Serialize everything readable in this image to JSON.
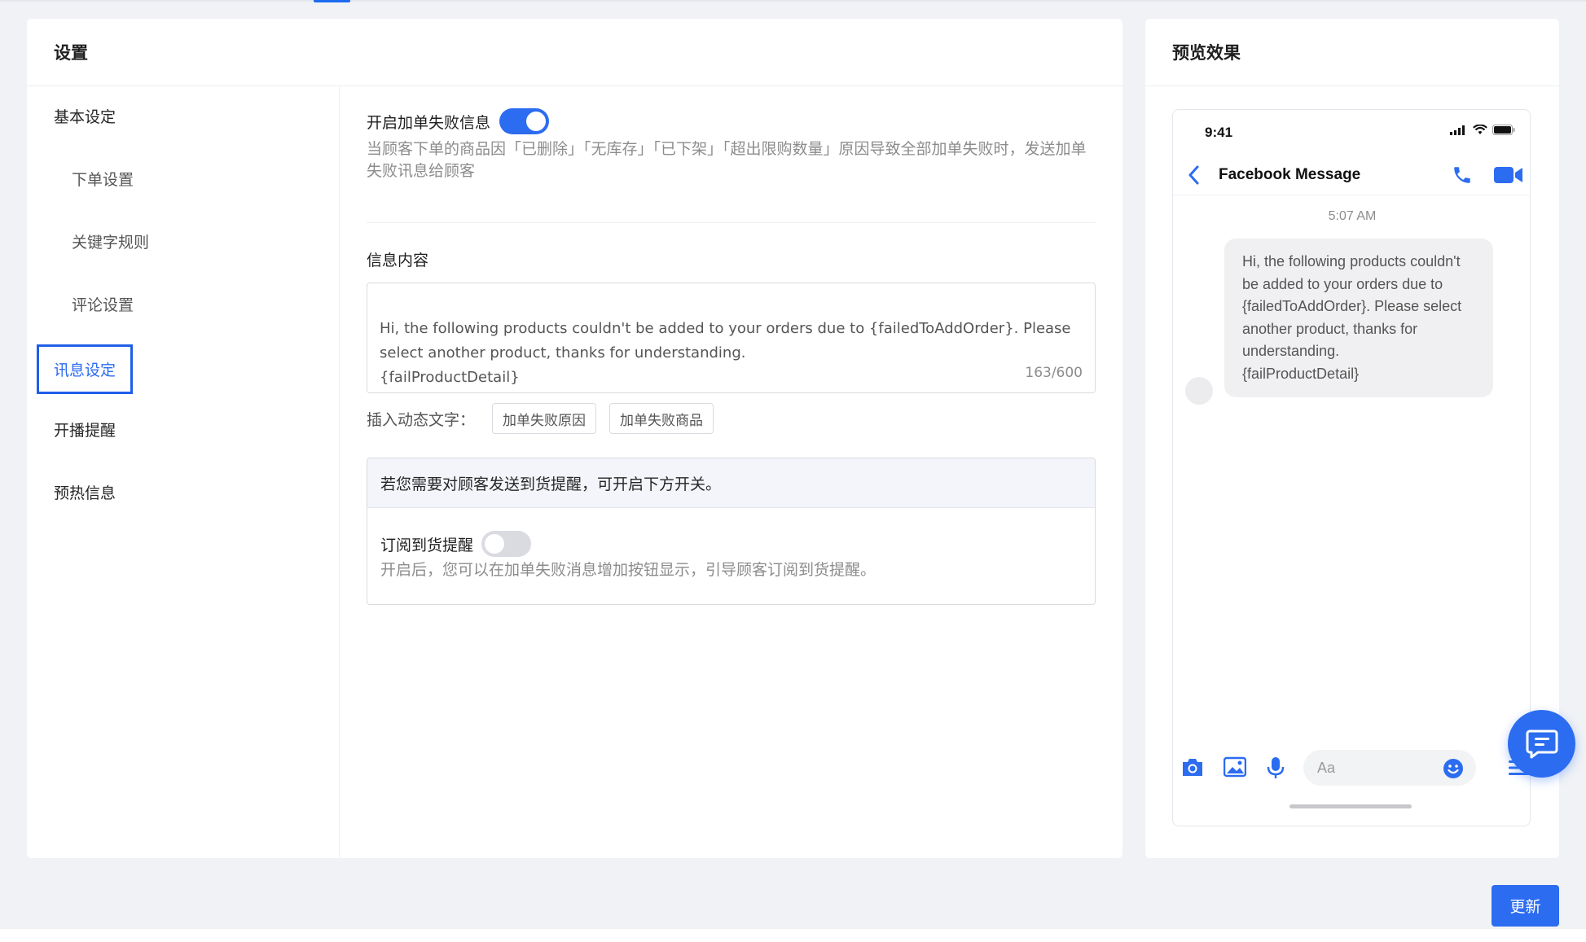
{
  "settings": {
    "title": "设置",
    "nav": [
      {
        "label": "基本设定"
      },
      {
        "label": "下单设置"
      },
      {
        "label": "关键字规则"
      },
      {
        "label": "评论设置"
      },
      {
        "label": "讯息设定"
      },
      {
        "label": "开播提醒"
      },
      {
        "label": "预热信息"
      }
    ],
    "active_nav": "讯息设定",
    "fail_msg": {
      "label": "开启加单失败信息",
      "enabled": true,
      "description": "当顾客下单的商品因「已删除」「无库存」「已下架」「超出限购数量」原因导致全部加单失败时，发送加单失败讯息给顾客"
    },
    "message_content": {
      "label": "信息内容",
      "value": "Hi, the following products couldn't be added to your orders due to {failedToAddOrder}. Please select another product, thanks for understanding.\n{failProductDetail}",
      "count": "163/600"
    },
    "insert_dynamic": {
      "label": "插入动态文字：",
      "tags": [
        "加单失败原因",
        "加单失败商品"
      ]
    },
    "reminder": {
      "notice": "若您需要对顾客发送到货提醒，可开启下方开关。",
      "label": "订阅到货提醒",
      "enabled": false,
      "description": "开启后，您可以在加单失败消息增加按钮显示，引导顾客订阅到货提醒。"
    }
  },
  "preview": {
    "title": "预览效果",
    "phone": {
      "status_time": "9:41",
      "chat_title": "Facebook Message",
      "message_time": "5:07 AM",
      "bubble_text": "Hi, the following products couldn't be added to your orders due to {failedToAddOrder}. Please select another product, thanks for understanding.\n{failProductDetail}",
      "input_placeholder": "Aa"
    }
  },
  "footer": {
    "update_label": "更新"
  },
  "colors": {
    "accent": "#2c6cf0",
    "active_outline": "#1f5ee8",
    "muted_text": "#8c8c8c"
  },
  "icons": [
    "back-chevron-icon",
    "phone-call-icon",
    "video-camera-icon",
    "camera-icon",
    "image-icon",
    "microphone-icon",
    "emoji-icon",
    "menu-icon",
    "chat-bubble-icon",
    "signal-icon",
    "wifi-icon",
    "battery-icon"
  ]
}
